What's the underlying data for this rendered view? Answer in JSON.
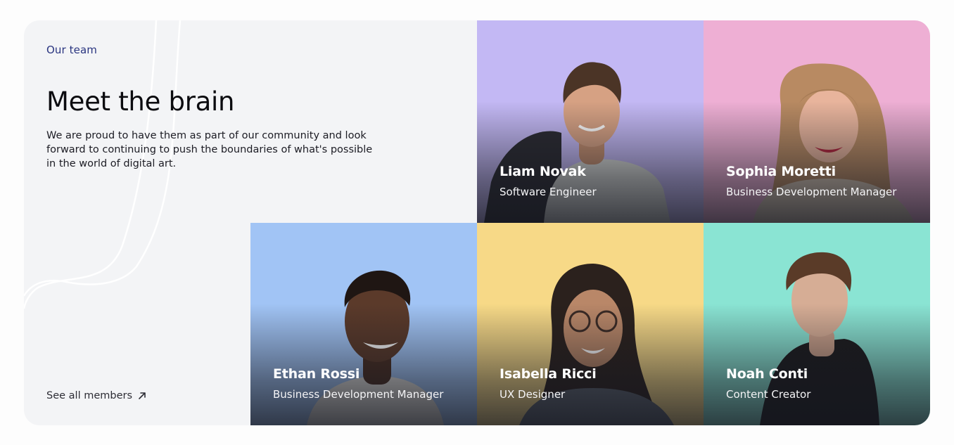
{
  "section": {
    "eyebrow": "Our team",
    "title": "Meet the brain",
    "description": "We are proud to have them as part of our community and look forward to continuing to push the boundaries of what's possible in the world of digital art.",
    "see_all_label": "See all members",
    "see_all_icon": "arrow-up-right-icon"
  },
  "members": [
    {
      "name": "Liam Novak",
      "role": "Software Engineer",
      "color": "#c3b8f4"
    },
    {
      "name": "Sophia Moretti",
      "role": "Business Development Manager",
      "color": "#eeafd4"
    },
    {
      "name": "Ethan Rossi",
      "role": "Business Development Manager",
      "color": "#a1c4f5"
    },
    {
      "name": "Isabella Ricci",
      "role": "UX Designer",
      "color": "#f7d987"
    },
    {
      "name": "Noah Conti",
      "role": "Content Creator",
      "color": "#8ae4d3"
    }
  ]
}
